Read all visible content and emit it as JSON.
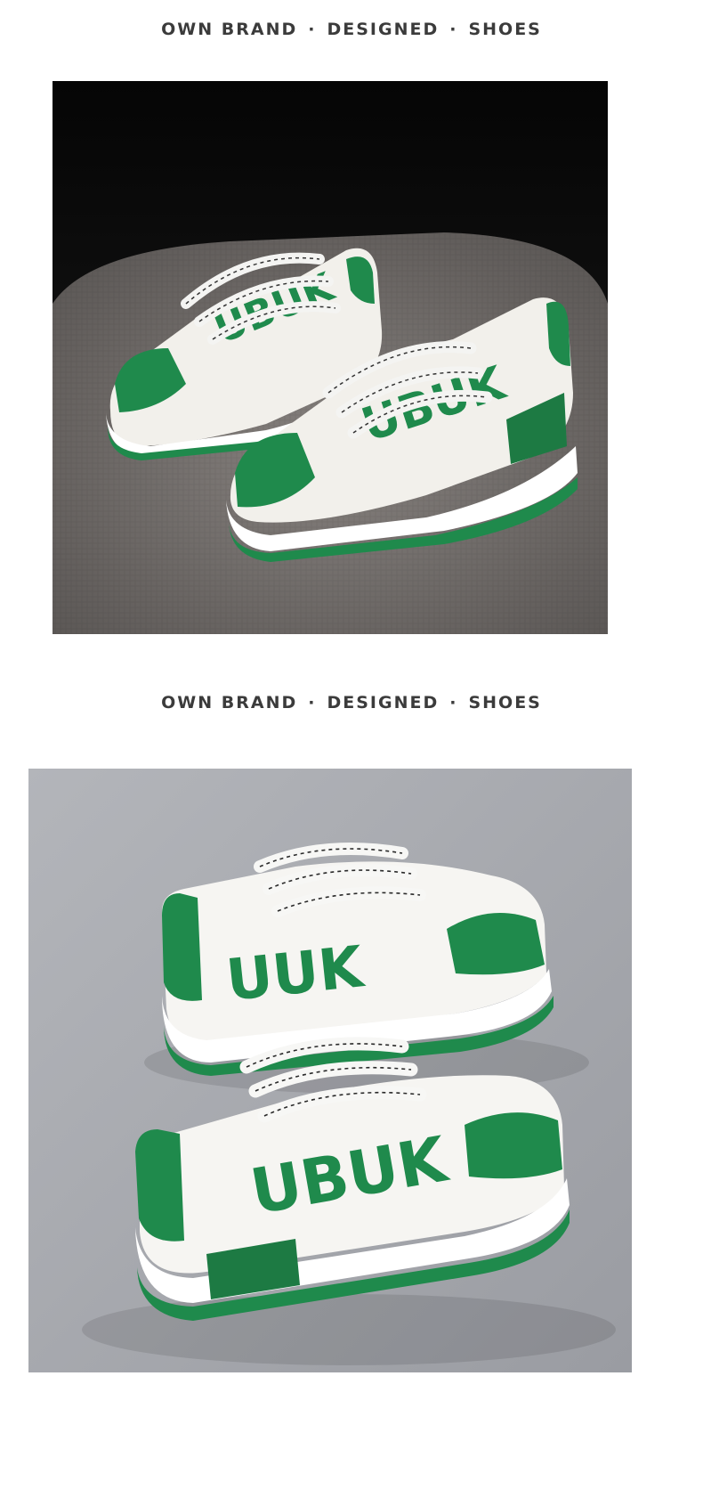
{
  "sections": [
    {
      "heading": {
        "part1": "OWN BRAND",
        "part2": "DESIGNED",
        "part3": "SHOES",
        "separator": "·"
      },
      "photo": {
        "description_icon": "sneaker-pair-photo",
        "background": "#0e0e0e",
        "surface": "#6f6b69",
        "accent": "#1f8a4c"
      }
    },
    {
      "heading": {
        "part1": "OWN BRAND",
        "part2": "DESIGNED",
        "part3": "SHOES",
        "separator": "·"
      },
      "photo": {
        "description_icon": "sneaker-pair-photo",
        "background": "#a6a8ad",
        "accent": "#1f8a4c"
      }
    }
  ]
}
